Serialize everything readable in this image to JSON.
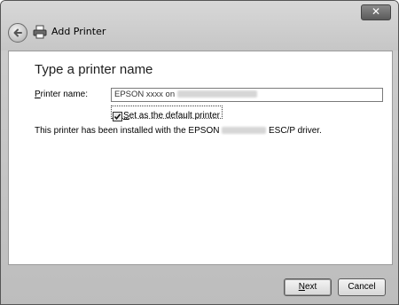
{
  "window": {
    "title": "Add Printer",
    "close_glyph": "✕"
  },
  "main": {
    "heading": "Type a printer name",
    "printer_name_label_accel": "P",
    "printer_name_label_rest": "rinter name:",
    "printer_name_value": "EPSON xxxx on",
    "set_default_accel": "S",
    "set_default_rest": "et as the default printer",
    "set_default_checked": true,
    "info_prefix": "This printer has been installed with the EPSON",
    "info_suffix": "ESC/P driver."
  },
  "footer": {
    "next_accel": "N",
    "next_rest": "ext",
    "cancel_label": "Cancel"
  },
  "icons": {
    "back": "back-arrow-icon",
    "printer": "printer-icon",
    "close": "close-icon",
    "check": "checkmark-icon"
  }
}
